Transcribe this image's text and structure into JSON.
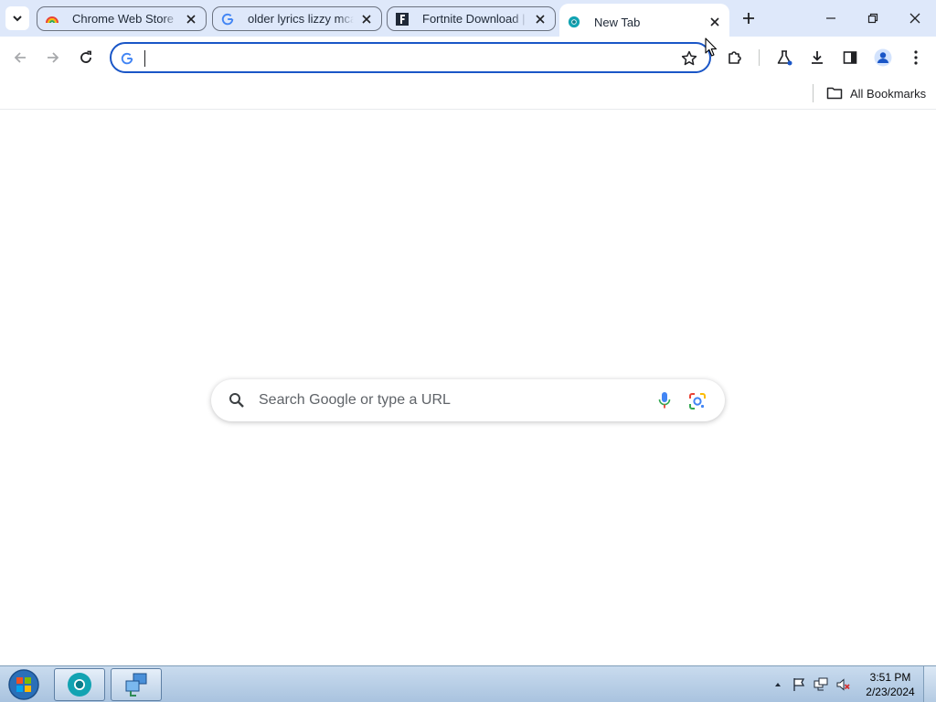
{
  "tabs": [
    {
      "title": "Chrome Web Store",
      "icon": "chrome-web-store-icon"
    },
    {
      "title": "older lyrics lizzy mcalpine - Google Search",
      "icon": "google-g-icon"
    },
    {
      "title": "Fortnite Download | All Things Fortnite",
      "icon": "fortnite-f-icon"
    },
    {
      "title": "New Tab",
      "icon": "chromium-icon",
      "active": true
    }
  ],
  "omnibox": {
    "value": "",
    "placeholder": ""
  },
  "bookmarks_bar": {
    "all_bookmarks_label": "All Bookmarks"
  },
  "ntp": {
    "search_placeholder": "Search Google or type a URL"
  },
  "taskbar": {
    "time": "3:51 PM",
    "date": "2/23/2024"
  },
  "colors": {
    "accent": "#1a56c7",
    "tabstrip": "#dee8fa",
    "taskbar": "#b9cfe6"
  }
}
